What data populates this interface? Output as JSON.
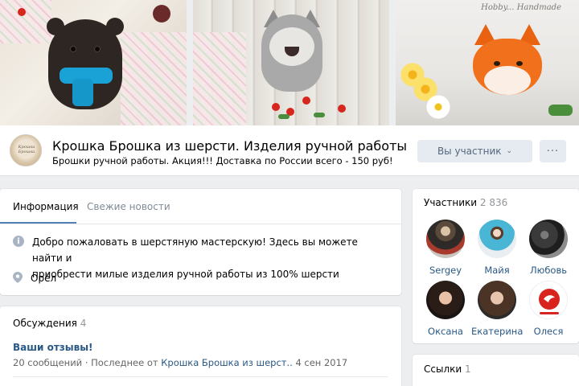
{
  "cover": {
    "watermark": "Hobby... Handmade"
  },
  "header": {
    "avatar_text": "Крошка Брошка",
    "group_name": "Крошка Брошка из шерсти. Изделия ручной работы",
    "status": "Брошки ручной работы. Акция!!! Доставка по России всего - 150 руб!",
    "member_button": "Вы участник",
    "more_button": "···"
  },
  "tabs": [
    {
      "label": "Информация"
    },
    {
      "label": "Свежие новости"
    }
  ],
  "info": {
    "description_line1": "Добро пожаловать в шерстяную мастерскую! Здесь вы можете найти и",
    "description_line2": "приобрести милые изделия ручной работы из 100% шерсти",
    "city": "Орёл"
  },
  "discussions": {
    "title": "Обсуждения",
    "count": "4",
    "topic": "Ваши отзывы!",
    "messages": "20 сообщений",
    "separator": "·",
    "last_prefix": "Последнее от",
    "last_author": "Крошка Брошка из шерст..",
    "last_date": "4 сен 2017"
  },
  "members": {
    "title": "Участники",
    "count": "2 836",
    "items": [
      {
        "name": "Sergey"
      },
      {
        "name": "Майя"
      },
      {
        "name": "Любовь"
      },
      {
        "name": "Оксана"
      },
      {
        "name": "Екатерина"
      },
      {
        "name": "Олеся"
      }
    ]
  },
  "links": {
    "title": "Ссылки",
    "count": "1"
  },
  "colors": {
    "link": "#2a5885",
    "accent": "#5181b8",
    "button_bg": "#e5ebf1",
    "page_bg": "#edeef0"
  }
}
